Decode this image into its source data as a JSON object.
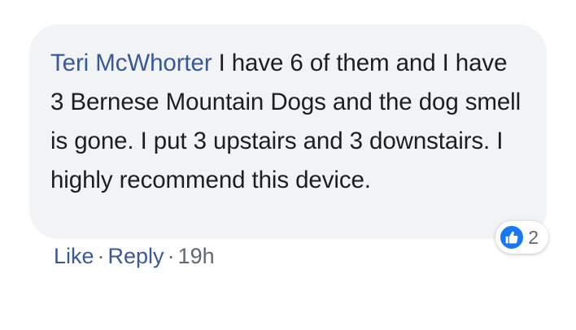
{
  "comment": {
    "author": "Teri McWhorter",
    "text": "I have 6 of them and I have 3 Bernese Mountain Dogs and the dog smell is gone. I put 3 upstairs and 3 downstairs. I highly recommend this device.",
    "reactions": {
      "icon": "thumbs-up-icon",
      "count": "2",
      "color": "#1877f2"
    },
    "actions": {
      "like_label": "Like",
      "reply_label": "Reply",
      "separator": "·",
      "timestamp": "19h"
    }
  },
  "colors": {
    "bubble_background": "#f2f3f5",
    "author_link": "#385898",
    "body_text": "#1c1e21",
    "meta_text": "#606770"
  }
}
